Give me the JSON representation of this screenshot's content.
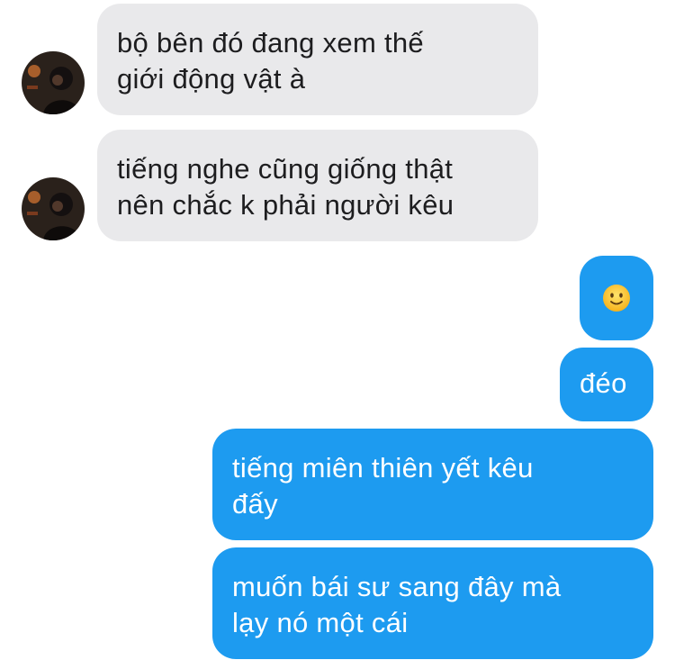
{
  "conversation": {
    "messages": [
      {
        "sender": "other",
        "text": "bộ bên đó đang xem thế\ngiới động vật à"
      },
      {
        "sender": "other",
        "text": "tiếng nghe cũng giống thật\nnên chắc k phải người kêu"
      },
      {
        "sender": "me",
        "emoji": "slightly-smiling-face-emoji"
      },
      {
        "sender": "me",
        "text": "đéo"
      },
      {
        "sender": "me",
        "text": "tiếng miên thiên yết kêu\nđấy"
      },
      {
        "sender": "me",
        "text": "muốn bái sư sang đây mà\nlạy nó một cái"
      }
    ]
  },
  "colors": {
    "incoming_bubble": "#e9e9eb",
    "outgoing_bubble": "#1d9bf0",
    "outgoing_text": "#ffffff",
    "incoming_text": "#1d1d1f"
  }
}
